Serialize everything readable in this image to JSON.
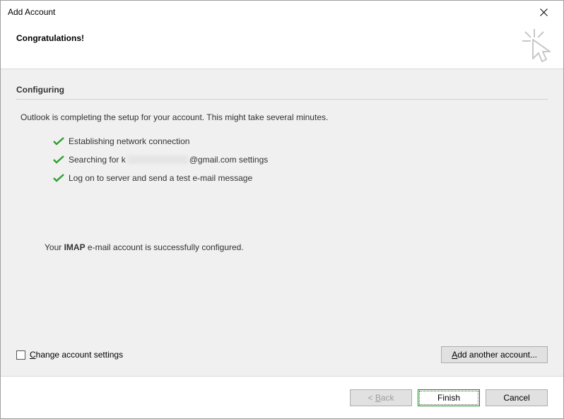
{
  "window": {
    "title": "Add Account"
  },
  "header": {
    "headline": "Congratulations!"
  },
  "configuring": {
    "section_title": "Configuring",
    "intro": "Outlook is completing the setup for your account. This might take several minutes.",
    "steps": [
      {
        "label": "Establishing network connection"
      },
      {
        "label_prefix": "Searching for k",
        "label_suffix": "@gmail.com settings"
      },
      {
        "label": "Log on to server and send a test e-mail message"
      }
    ],
    "success_prefix": "Your ",
    "success_bold": "IMAP",
    "success_suffix": " e-mail account is successfully configured."
  },
  "options": {
    "change_settings_c": "C",
    "change_settings_rest": "hange account settings",
    "add_another_a": "A",
    "add_another_rest": "dd another account..."
  },
  "buttons": {
    "back_lt": "< ",
    "back_b": "B",
    "back_rest": "ack",
    "finish": "Finish",
    "cancel": "Cancel"
  }
}
